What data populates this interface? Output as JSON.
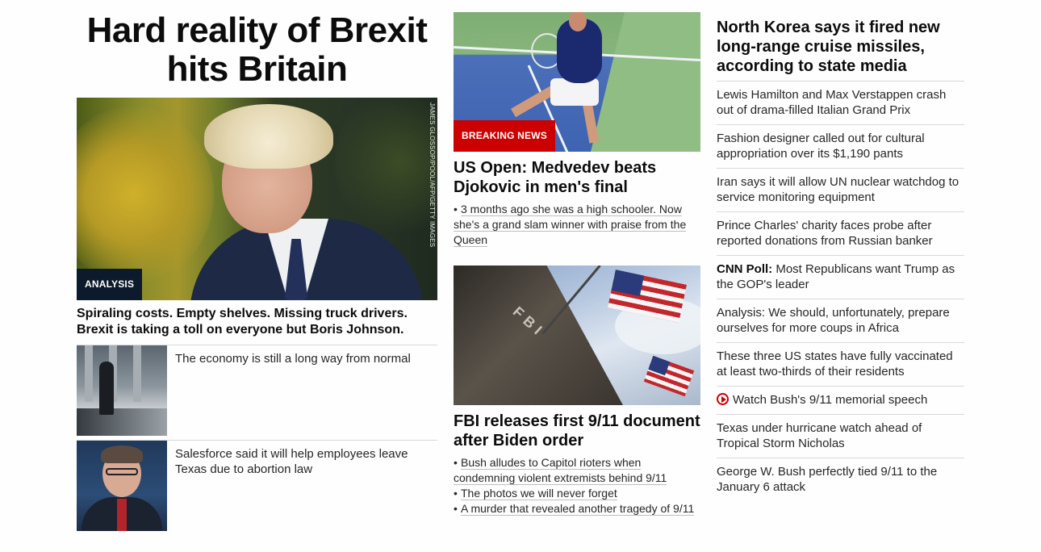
{
  "hero": {
    "title": "Hard reality of Brexit hits Britain",
    "badge": "ANALYSIS",
    "image_credit": "JAMES GLOSSOP/POOL/AFP/GETTY IMAGES",
    "subtitle": "Spiraling costs. Empty shelves. Missing truck drivers. Brexit is taking a toll on everyone but Boris Johnson.",
    "related": [
      {
        "text": "The economy is still a long way from normal"
      },
      {
        "text": "Salesforce said it will help employees leave Texas due to abortion law"
      }
    ]
  },
  "middle": {
    "story1": {
      "badge": "BREAKING NEWS",
      "title": "US Open: Medvedev beats Djokovic in men's final",
      "bullets": [
        "3 months ago she was a high schooler. Now she's a grand slam winner with praise from the Queen"
      ]
    },
    "story2": {
      "image_text": "FBI",
      "title": "FBI releases first 9/11 document after Biden order",
      "bullets": [
        "Bush alludes to Capitol rioters when condemning violent extremists behind 9/11",
        "The photos we will never forget",
        "A murder that revealed another tragedy of 9/11"
      ]
    }
  },
  "right": {
    "lead": "North Korea says it fired new long-range cruise missiles, according to state media",
    "items": [
      {
        "text": "Lewis Hamilton and Max Verstappen crash out of drama-filled Italian Grand Prix"
      },
      {
        "text": "Fashion designer called out for cultural appropriation over its $1,190 pants"
      },
      {
        "text": "Iran says it will allow UN nuclear watchdog to service monitoring equipment"
      },
      {
        "text": "Prince Charles' charity faces probe after reported donations from Russian banker"
      },
      {
        "prefix": "CNN Poll:",
        "text": " Most Republicans want Trump as the GOP's leader"
      },
      {
        "text": "Analysis: We should, unfortunately, prepare ourselves for more coups in Africa"
      },
      {
        "text": "These three US states have fully vaccinated at least two-thirds of their residents"
      },
      {
        "icon": "play-icon",
        "text": "Watch Bush's 9/11 memorial speech"
      },
      {
        "text": "Texas under hurricane watch ahead of Tropical Storm Nicholas"
      },
      {
        "text": "George W. Bush perfectly tied 9/11 to the January 6 attack"
      }
    ]
  },
  "colors": {
    "breaking": "#cc0000",
    "analysis_badge": "#0c1a2b",
    "divider": "#d9d9d9"
  }
}
